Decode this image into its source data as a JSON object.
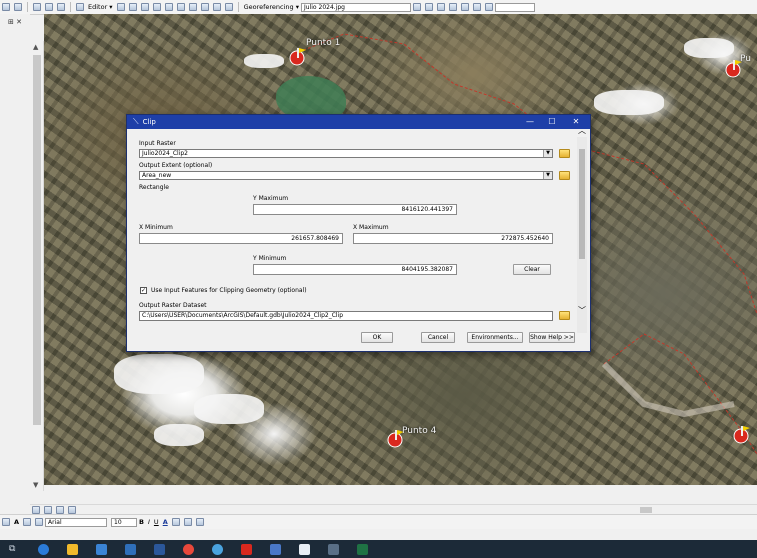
{
  "toolbar": {
    "editor_label": "Editor ▾",
    "georef_label": "Georeferencing ▾",
    "layer_select": "Julio 2024.jpg"
  },
  "map": {
    "points": [
      {
        "label": "Punto 1"
      },
      {
        "label": "Punto 4"
      },
      {
        "label": "Pu"
      }
    ]
  },
  "dialog": {
    "title": "Clip",
    "input_raster_label": "Input Raster",
    "input_raster_value": "Julio2024_Clip2",
    "output_extent_label": "Output Extent (optional)",
    "output_extent_value": "Area_new",
    "rectangle_label": "Rectangle",
    "ymax_label": "Y Maximum",
    "ymax_value": "8416120.441397",
    "xmin_label": "X Minimum",
    "xmin_value": "261657.808469",
    "xmax_label": "X Maximum",
    "xmax_value": "272875.452640",
    "ymin_label": "Y Minimum",
    "ymin_value": "8404195.382087",
    "clear_label": "Clear",
    "use_input_features_label": "Use Input Features for Clipping Geometry (optional)",
    "use_input_features_checked": true,
    "output_dataset_label": "Output Raster Dataset",
    "output_dataset_value": "C:\\Users\\USER\\Documents\\ArcGIS\\Default.gdb\\Julio2024_Clip2_Clip",
    "ok_label": "OK",
    "cancel_label": "Cancel",
    "env_label": "Environments...",
    "help_label": "Show Help >>"
  },
  "draw_toolbar": {
    "font": "Arial",
    "size": "10",
    "bold": "B",
    "italic": "I",
    "underline": "U"
  },
  "colors": {
    "title_bar": "#1e3fa8",
    "taskbar": "#1c2a38",
    "marker": "#d9281e",
    "boundary": "#c0392b"
  }
}
